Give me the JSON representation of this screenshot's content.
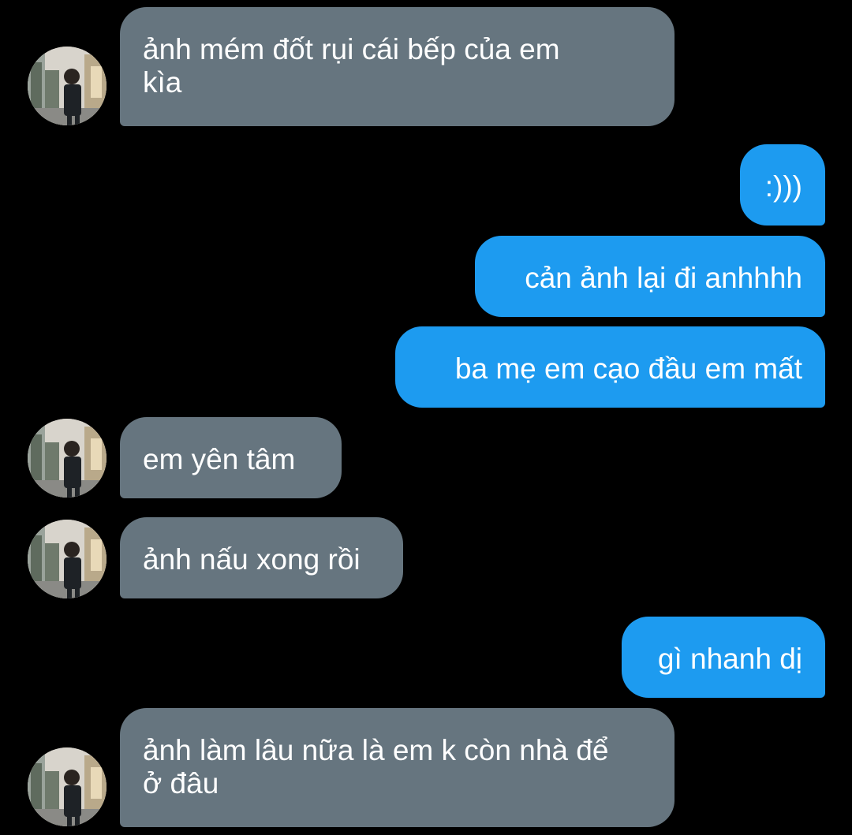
{
  "conversation": {
    "messages": [
      {
        "sender": "other",
        "text": "ảnh mém đốt rụi cái bếp của em\nkìa"
      },
      {
        "sender": "me",
        "text": ":)))"
      },
      {
        "sender": "me",
        "text": "cản ảnh lại đi anhhhh"
      },
      {
        "sender": "me",
        "text": "ba mẹ em cạo đầu em mất"
      },
      {
        "sender": "other",
        "text": "em yên tâm"
      },
      {
        "sender": "other",
        "text": "ảnh nấu xong rồi"
      },
      {
        "sender": "me",
        "text": "gì nhanh dị"
      },
      {
        "sender": "other",
        "text": "ảnh làm lâu nữa là em k còn nhà để\nở đâu"
      }
    ]
  },
  "colors": {
    "background": "#000000",
    "incoming_bubble": "#66757f",
    "outgoing_bubble": "#1d9bf0",
    "text": "#ffffff"
  },
  "icons": {
    "avatar": "profile-photo-avatar"
  }
}
